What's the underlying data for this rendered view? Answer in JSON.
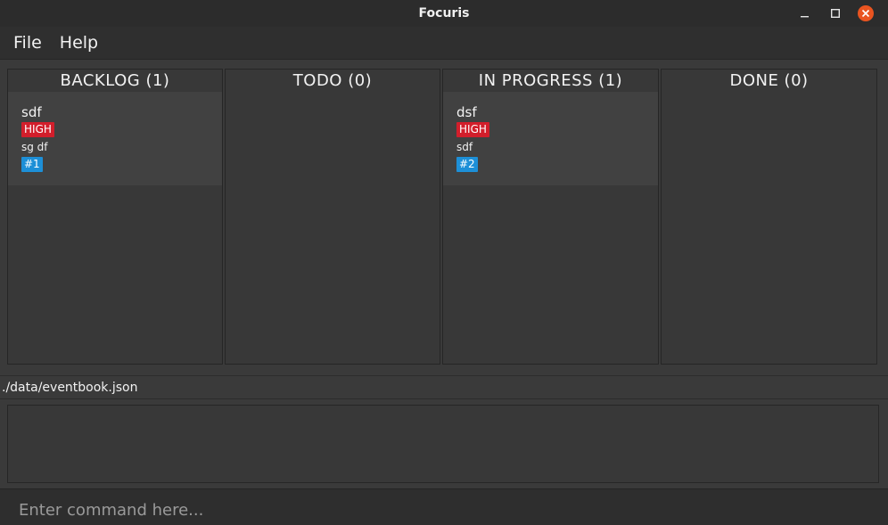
{
  "window": {
    "title": "Focuris",
    "minimize_icon": "minimize-icon",
    "maximize_icon": "maximize-icon",
    "close_icon": "close-icon",
    "close_color": "#e95420"
  },
  "menu": {
    "items": [
      {
        "label": "File"
      },
      {
        "label": "Help"
      }
    ]
  },
  "board": {
    "columns": [
      {
        "title": "BACKLOG (1)",
        "cards": [
          {
            "title": "sdf",
            "priority": "HIGH",
            "description": "sg df",
            "id": "#1"
          }
        ]
      },
      {
        "title": "TODO (0)",
        "cards": []
      },
      {
        "title": "IN PROGRESS (1)",
        "cards": [
          {
            "title": "dsf",
            "priority": "HIGH",
            "description": "sdf",
            "id": "#2"
          }
        ]
      },
      {
        "title": "DONE (0)",
        "cards": []
      }
    ]
  },
  "status": {
    "file_path": "./data/eventbook.json"
  },
  "result_display": {
    "text": ""
  },
  "command": {
    "placeholder": "Enter command here...",
    "value": ""
  },
  "colors": {
    "background": "#3a3a3a",
    "priority_high": "#d21e2b",
    "id_badge": "#1d8fd7"
  }
}
